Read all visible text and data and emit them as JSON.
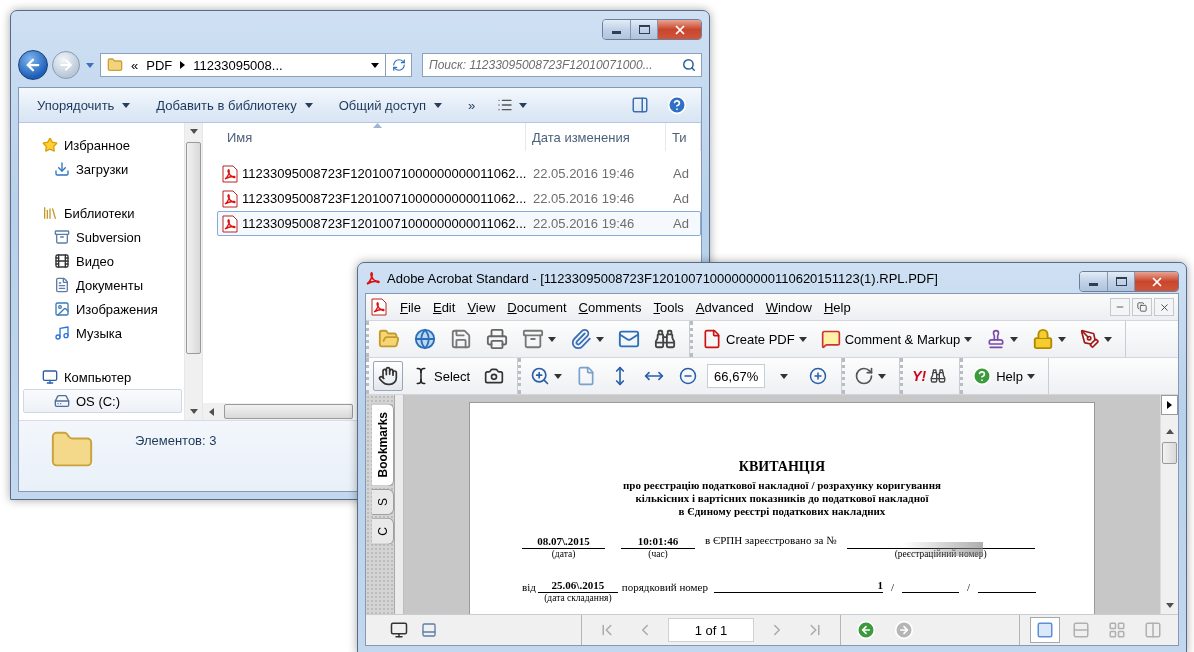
{
  "explorer": {
    "address": {
      "prefix": "«",
      "segments": [
        "PDF",
        "11233095008..."
      ]
    },
    "search": {
      "placeholder": "Поиск: 11233095008723F12010071000..."
    },
    "toolbar": [
      {
        "label": "Упорядочить"
      },
      {
        "label": "Добавить в библиотеку"
      },
      {
        "label": "Общий доступ"
      }
    ],
    "overflow": "»",
    "sidebar": [
      {
        "label": "Избранное",
        "kind": "favorites",
        "selected": false,
        "children": [
          {
            "label": "Загрузки",
            "kind": "downloads",
            "selected": false
          }
        ]
      },
      {
        "label": "Библиотеки",
        "kind": "libraries",
        "selected": false,
        "children": [
          {
            "label": "Subversion",
            "kind": "repository",
            "selected": false
          },
          {
            "label": "Видео",
            "kind": "video",
            "selected": false
          },
          {
            "label": "Документы",
            "kind": "documents",
            "selected": false
          },
          {
            "label": "Изображения",
            "kind": "pictures",
            "selected": false
          },
          {
            "label": "Музыка",
            "kind": "music",
            "selected": false
          }
        ]
      },
      {
        "label": "Компьютер",
        "kind": "computer",
        "selected": false,
        "children": [
          {
            "label": "OS (C:)",
            "kind": "drive",
            "selected": true
          }
        ]
      }
    ],
    "columns": [
      {
        "label": "Имя",
        "sorted": true
      },
      {
        "label": "Дата изменения",
        "sorted": false
      },
      {
        "label": "Ти",
        "sorted": false
      }
    ],
    "files": [
      {
        "name": "11233095008723F12010071000000000011062...",
        "modified": "22.05.2016 19:46",
        "type": "Ad",
        "selected": false
      },
      {
        "name": "11233095008723F12010071000000000011062...",
        "modified": "22.05.2016 19:46",
        "type": "Ad",
        "selected": false
      },
      {
        "name": "11233095008723F12010071000000000011062...",
        "modified": "22.05.2016 19:46",
        "type": "Ad",
        "selected": true
      }
    ],
    "status": "Элементов: 3"
  },
  "acrobat": {
    "title": "Adobe Acrobat Standard - [11233095008723F12010071000000000110620151123(1).RPL.PDF]",
    "menu": [
      "File",
      "Edit",
      "View",
      "Document",
      "Comments",
      "Tools",
      "Advanced",
      "Window",
      "Help"
    ],
    "create_pdf": "Create PDF",
    "comment_markup": "Comment & Markup",
    "hand_tool": {
      "selected": true
    },
    "select_tool": {
      "label": "Select",
      "selected": false
    },
    "zoom": "66,67%",
    "logo": "Y!",
    "help": "Help",
    "side_tabs": [
      {
        "label": "Bookmarks",
        "selected": true
      },
      {
        "label": "S",
        "selected": false
      },
      {
        "label": "C",
        "selected": false
      }
    ],
    "document": {
      "title": "КВИТАНЦІЯ",
      "subtitle": [
        "про реєстрацію податкової накладної / розрахунку коригування",
        "кількісних і вартісних показників до податкової накладної",
        "в Єдиному реєстрі податкових накладних"
      ],
      "date": {
        "value": "08.07\\.2015",
        "caption": "(дата)"
      },
      "time": {
        "value": "10:01:46",
        "caption": "(час)"
      },
      "registered_label": "в ЄРПН зареєстровано за №",
      "registration_caption": "(реєстраційний номер)",
      "from_label": "від",
      "issue_date": {
        "value": "25.06\\.2015",
        "caption": "(дата складання)"
      },
      "serial_label": "порядковий номер",
      "serial_value": "1",
      "separators": [
        "/",
        "/"
      ]
    },
    "page_nav": "1 of 1",
    "page_layouts": [
      {
        "kind": "single",
        "selected": true
      },
      {
        "kind": "continuous",
        "selected": false
      },
      {
        "kind": "continuous-facing",
        "selected": false
      },
      {
        "kind": "facing",
        "selected": false
      }
    ]
  }
}
